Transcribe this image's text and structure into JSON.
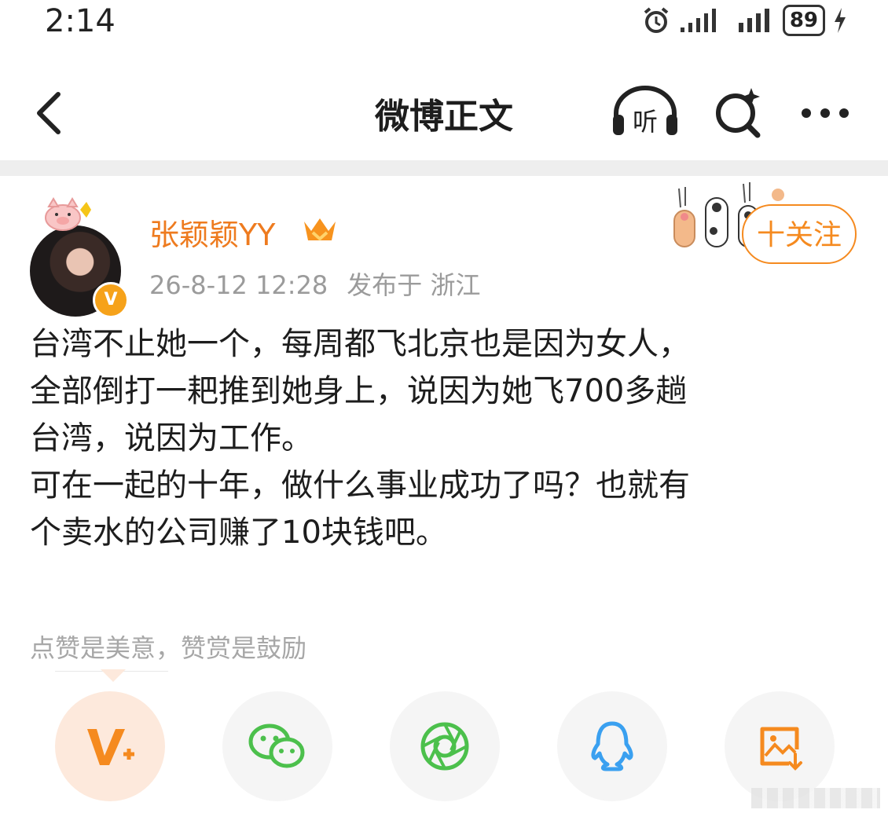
{
  "status_bar": {
    "time": "2:14",
    "battery": "89",
    "icons": [
      "alarm-icon",
      "signal-icon",
      "signal-icon",
      "battery-icon",
      "charging-icon"
    ]
  },
  "nav": {
    "title": "微博正文",
    "listen_label": "听",
    "icons": [
      "back-icon",
      "listen-icon",
      "search-icon",
      "more-icon"
    ]
  },
  "post": {
    "username": "张颖颖YY",
    "timestamp": "26-8-12 12:28",
    "location": "发布于 浙江",
    "follow_label": "十关注",
    "verified_mark": "V",
    "body_lines": [
      "台湾不止她一个，每周都飞北京也是因为女人，",
      "全部倒打一耙推到她身上，说因为她飞700多趟",
      "台湾，说因为工作。",
      "可在一起的十年，做什么事业成功了吗？也就有",
      "个卖水的公司赚了10块钱吧。"
    ]
  },
  "reward": {
    "tip": "点赞是美意，赞赏是鼓励"
  },
  "share": {
    "items": [
      {
        "name": "vplus",
        "color": "#f58a1f"
      },
      {
        "name": "wechat",
        "color": "#4cc04c"
      },
      {
        "name": "moments",
        "color": "#4cc04c"
      },
      {
        "name": "qq",
        "color": "#3aa0f0"
      },
      {
        "name": "save-image",
        "color": "#f58a1f"
      }
    ]
  },
  "colors": {
    "accent_orange": "#f58a1f",
    "username": "#ee7b1f",
    "meta_gray": "#9b9b9b"
  }
}
